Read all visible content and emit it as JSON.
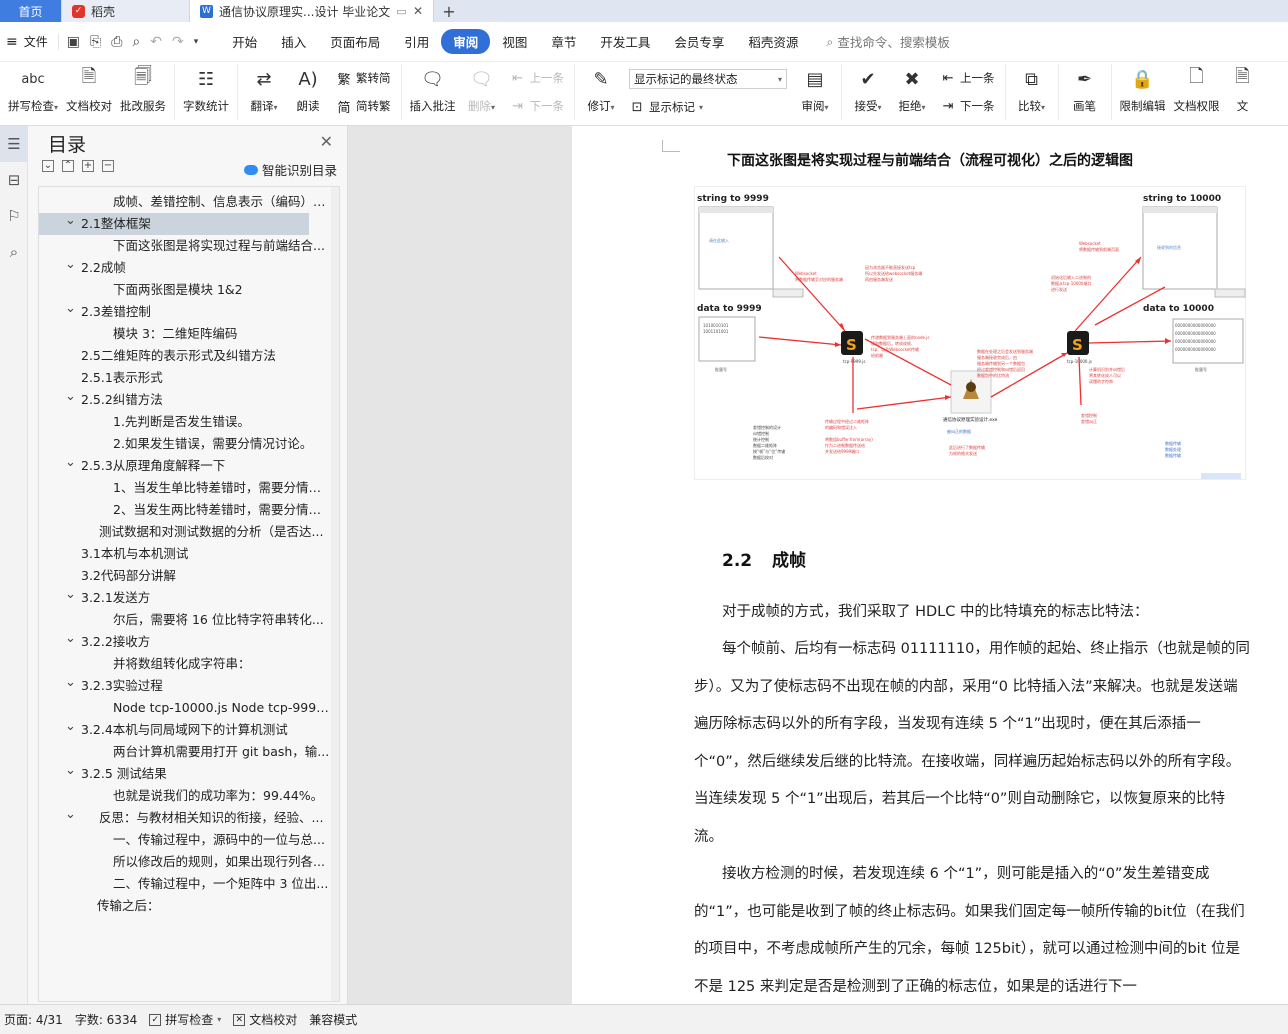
{
  "tabs": {
    "home": "首页",
    "daoke": "稻壳",
    "doc": "通信协议原理实...设计 毕业论文"
  },
  "menubar": {
    "file": "文件",
    "items": [
      "开始",
      "插入",
      "页面布局",
      "引用",
      "审阅",
      "视图",
      "章节",
      "开发工具",
      "会员专享",
      "稻壳资源"
    ],
    "active": "审阅",
    "search_placeholder": "查找命令、搜索模板"
  },
  "ribbon": {
    "spell": "拼写检查",
    "proof": "文档校对",
    "batch": "批改服务",
    "wordcount": "字数统计",
    "translate": "翻译",
    "read": "朗读",
    "to_trad": "繁转简",
    "to_simp": "简转繁",
    "insert_comment": "插入批注",
    "delete": "删除",
    "prev": "上一条",
    "next": "下一条",
    "track": "修订",
    "display_select": "显示标记的最终状态",
    "show_marks": "显示标记",
    "review": "审阅",
    "accept": "接受",
    "reject": "拒绝",
    "prev2": "上一条",
    "next2": "下一条",
    "compare": "比较",
    "pen": "画笔",
    "restrict": "限制编辑",
    "doc_perm": "文档权限",
    "more": "文"
  },
  "toc": {
    "title": "目录",
    "smart": "智能识别目录",
    "items": [
      {
        "text": "成帧、差错控制、信息表示（编码）等...",
        "level": 3,
        "chev": false
      },
      {
        "text": "2.1整体框架",
        "level": 1,
        "chev": true,
        "selected": true
      },
      {
        "text": "下面这张图是将实现过程与前端结合...",
        "level": 3,
        "chev": false
      },
      {
        "text": "2.2成帧",
        "level": 1,
        "chev": true
      },
      {
        "text": "下面两张图是模块 1&2",
        "level": 3,
        "chev": false
      },
      {
        "text": "2.3差错控制",
        "level": 1,
        "chev": true
      },
      {
        "text": "模块 3：二维矩阵编码",
        "level": 3,
        "chev": false
      },
      {
        "text": "2.5二维矩阵的表示形式及纠错方法",
        "level": 1,
        "chev": false
      },
      {
        "text": "2.5.1表示形式",
        "level": 1,
        "chev": false
      },
      {
        "text": "2.5.2纠错方法",
        "level": 1,
        "chev": true
      },
      {
        "text": "1.先判断是否发生错误。",
        "level": 3,
        "chev": false
      },
      {
        "text": "2.如果发生错误，需要分情况讨论。",
        "level": 3,
        "chev": false
      },
      {
        "text": "2.5.3从原理角度解释一下",
        "level": 1,
        "chev": true
      },
      {
        "text": "1、当发生单比特差错时，需要分情况...",
        "level": 3,
        "chev": false
      },
      {
        "text": "2、当发生两比特差错时，需要分情况...",
        "level": 3,
        "chev": false
      },
      {
        "text": "测试数据和对测试数据的分析（是否达...",
        "level": 2,
        "chev": false
      },
      {
        "text": "3.1本机与本机测试",
        "level": 1,
        "chev": false
      },
      {
        "text": "3.2代码部分讲解",
        "level": 1,
        "chev": false
      },
      {
        "text": "3.2.1发送方",
        "level": 1,
        "chev": true
      },
      {
        "text": "尔后，需要将 16 位比特字符串转化...",
        "level": 3,
        "chev": false
      },
      {
        "text": "3.2.2接收方",
        "level": 1,
        "chev": true
      },
      {
        "text": "并将数组转化成字符串：",
        "level": 3,
        "chev": false
      },
      {
        "text": "3.2.3实验过程",
        "level": 1,
        "chev": true
      },
      {
        "text": "Node tcp-10000.js Node tcp-9999....",
        "level": 3,
        "chev": false
      },
      {
        "text": "3.2.4本机与同局域网下的计算机测试",
        "level": 1,
        "chev": true
      },
      {
        "text": "两台计算机需要用打开 git bash，输...",
        "level": 3,
        "chev": false
      },
      {
        "text": "3.2.5 测试结果",
        "level": 1,
        "chev": true
      },
      {
        "text": "也就是说我们的成功率为：99.44%。",
        "level": 3,
        "chev": false
      },
      {
        "text": "反思：与教材相关知识的衔接，经验、...",
        "level": 2,
        "chev": true
      },
      {
        "text": "一、传输过程中，源码中的一位与总...",
        "level": 3,
        "chev": false
      },
      {
        "text": "所以修改后的规则，如果出现行列各...",
        "level": 3,
        "chev": false
      },
      {
        "text": "二、传输过程中，一个矩阵中 3 位出...",
        "level": 3,
        "chev": false
      },
      {
        "text": "传输之后：",
        "level": 4,
        "chev": false
      }
    ]
  },
  "document": {
    "caption": "下面这张图是将实现过程与前端结合（流程可视化）之后的逻辑图",
    "figure": {
      "label_tl": "string to 9999",
      "label_tr": "string to 10000",
      "label_ml": "data to 9999",
      "label_mr": "data to 10000",
      "center_label": "通信协议原理实验设计.exe"
    },
    "heading_num": "2.2",
    "heading_text": "成帧",
    "p1": "对于成帧的方式，我们采取了 HDLC 中的比特填充的标志比特法：",
    "p2": "每个帧前、后均有一标志码 01111110，用作帧的起始、终止指示（也就是帧的同步）。又为了使标志码不出现在帧的内部，采用“0 比特插入法”来解决。也就是发送端遍历除标志码以外的所有字段，当发现有连续 5 个“1”出现时，便在其后添插一个“0”，然后继续发后继的比特流。在接收端，同样遍历起始标志码以外的所有字段。当连续发现 5 个“1”出现后，若其后一个比特“0”则自动删除它，以恢复原来的比特流。",
    "p3": "接收方检测的时候，若发现连续 6 个“1”，则可能是插入的“0”发生差错变成的“1”，也可能是收到了帧的终止标志码。如果我们固定每一帧所传输的bit位（在我们的项目中，不考虑成帧所产生的冗余，每帧 125bit），就可以通过检测中间的bit 位是不是 125 来判定是否是检测到了正确的标志位，如果是的话进行下一"
  },
  "status": {
    "page": "页面: 4/31",
    "words": "字数: 6334",
    "spell": "拼写检查",
    "proof": "文档校对",
    "compat": "兼容模式"
  }
}
